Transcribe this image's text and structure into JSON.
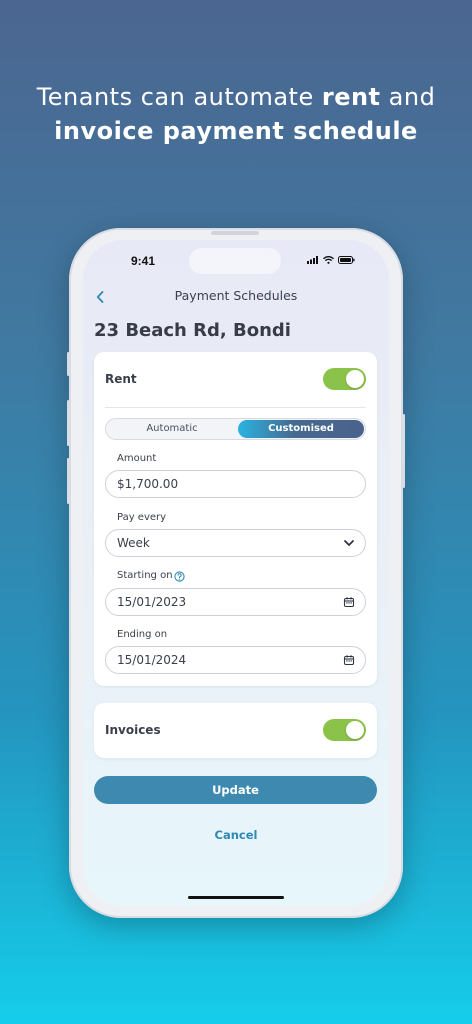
{
  "headline": {
    "line1_prefix": "Tenants can automate ",
    "line1_bold": "rent",
    "line1_suffix": " and",
    "line2_bold": "invoice payment schedule"
  },
  "status_bar": {
    "time": "9:41"
  },
  "nav": {
    "title": "Payment Schedules",
    "back_icon": "chevron-left-icon"
  },
  "property_title": "23 Beach Rd, Bondi",
  "rent_card": {
    "label": "Rent",
    "toggle_on": true,
    "mode": {
      "options": [
        "Automatic",
        "Customised"
      ],
      "selected": "Customised"
    },
    "amount": {
      "label": "Amount",
      "value": "$1,700.00"
    },
    "pay_every": {
      "label": "Pay every",
      "value": "Week"
    },
    "starting_on": {
      "label": "Starting on",
      "value": "15/01/2023"
    },
    "ending_on": {
      "label": "Ending on",
      "value": "15/01/2024"
    }
  },
  "invoices_card": {
    "label": "Invoices",
    "toggle_on": true
  },
  "actions": {
    "update": "Update",
    "cancel": "Cancel"
  },
  "colors": {
    "toggle_on": "#8bc34a",
    "primary_button": "#3d89b0",
    "link": "#2f89b3",
    "help_icon": "#2f89b3"
  }
}
